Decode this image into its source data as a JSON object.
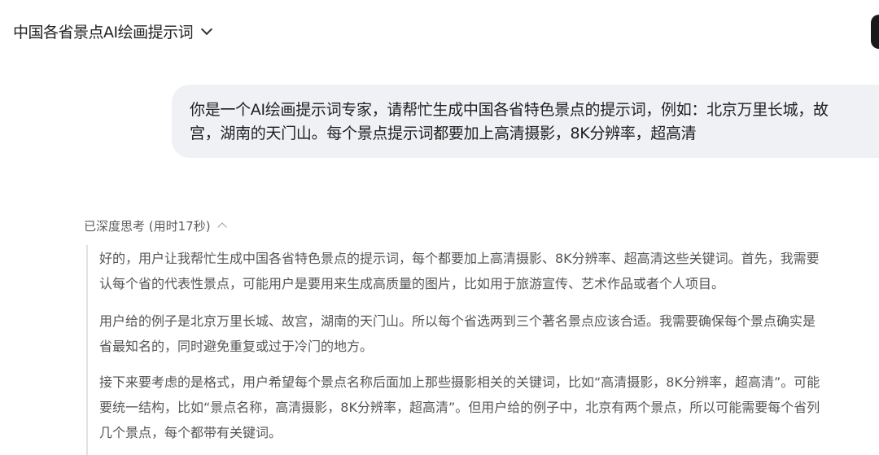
{
  "header": {
    "title": "中国各省景点AI绘画提示词"
  },
  "user_message": {
    "lines": [
      "你是一个AI绘画提示词专家，请帮忙生成中国各省特色景点的提示词，例如：北京万里长城，故",
      "宫，湖南的天门山。每个景点提示词都要加上高清摄影，8K分辨率，超高清"
    ]
  },
  "thinking": {
    "label": "已深度思考 (用时17秒)",
    "paragraphs": [
      {
        "lines": [
          "好的，用户让我帮忙生成中国各省特色景点的提示词，每个都要加上高清摄影、8K分辨率、超高清这些关键词。首先，我需要",
          "认每个省的代表性景点，可能用户是要用来生成高质量的图片，比如用于旅游宣传、艺术作品或者个人项目。"
        ]
      },
      {
        "lines": [
          "用户给的例子是北京万里长城、故宫，湖南的天门山。所以每个省选两到三个著名景点应该合适。我需要确保每个景点确实是",
          "省最知名的，同时避免重复或过于冷门的地方。"
        ]
      },
      {
        "lines": [
          "接下来要考虑的是格式，用户希望每个景点名称后面加上那些摄影相关的关键词，比如“高清摄影，8K分辨率，超高清”。可能",
          "要统一结构，比如“景点名称，高清摄影，8K分辨率，超高清”。但用户给的例子中，北京有两个景点，所以可能需要每个省列",
          "几个景点，每个都带有关键词。"
        ]
      }
    ]
  }
}
